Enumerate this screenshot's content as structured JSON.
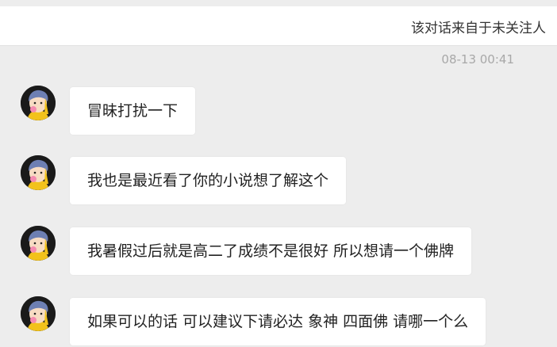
{
  "header": {
    "notice": "该对话来自于未关注人"
  },
  "conversation": {
    "timestamp": "08-13 00:41",
    "messages": [
      {
        "text": "冒昧打扰一下"
      },
      {
        "text": "我也是最近看了你的小说想了解这个"
      },
      {
        "text": "我暑假过后就是高二了成绩不是很好 所以想请一个佛牌"
      },
      {
        "text": "如果可以的话 可以建议下请必达 象神 四面佛 请哪一个么"
      }
    ]
  },
  "colors": {
    "background": "#ededed",
    "bubble": "#ffffff",
    "timestamp": "#a8a8a8"
  },
  "icons": {
    "avatar": "cartoon-girl-avatar-icon"
  }
}
